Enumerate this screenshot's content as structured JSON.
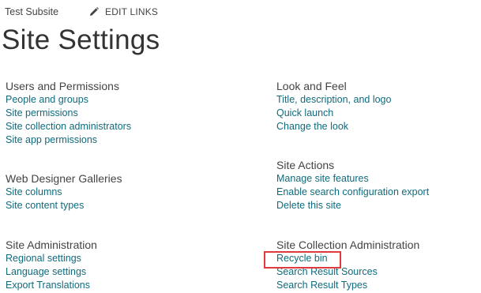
{
  "breadcrumb": {
    "site_name": "Test Subsite"
  },
  "edit_links": {
    "label": "EDIT LINKS",
    "icon": "pencil-icon"
  },
  "page_title": "Site Settings",
  "sections": {
    "users_permissions": {
      "heading": "Users and Permissions",
      "links": [
        "People and groups",
        "Site permissions",
        "Site collection administrators",
        "Site app permissions"
      ]
    },
    "web_designer_galleries": {
      "heading": "Web Designer Galleries",
      "links": [
        "Site columns",
        "Site content types"
      ]
    },
    "site_administration": {
      "heading": "Site Administration",
      "links": [
        "Regional settings",
        "Language settings",
        "Export Translations"
      ]
    },
    "look_and_feel": {
      "heading": "Look and Feel",
      "links": [
        "Title, description, and logo",
        "Quick launch",
        "Change the look"
      ]
    },
    "site_actions": {
      "heading": "Site Actions",
      "links": [
        "Manage site features",
        "Enable search configuration export",
        "Delete this site"
      ]
    },
    "site_collection_administration": {
      "heading": "Site Collection Administration",
      "links": [
        "Recycle bin",
        "Search Result Sources",
        "Search Result Types"
      ]
    }
  },
  "colors": {
    "link": "#0f6b7d",
    "text": "#444444",
    "highlight": "#e0393e"
  }
}
